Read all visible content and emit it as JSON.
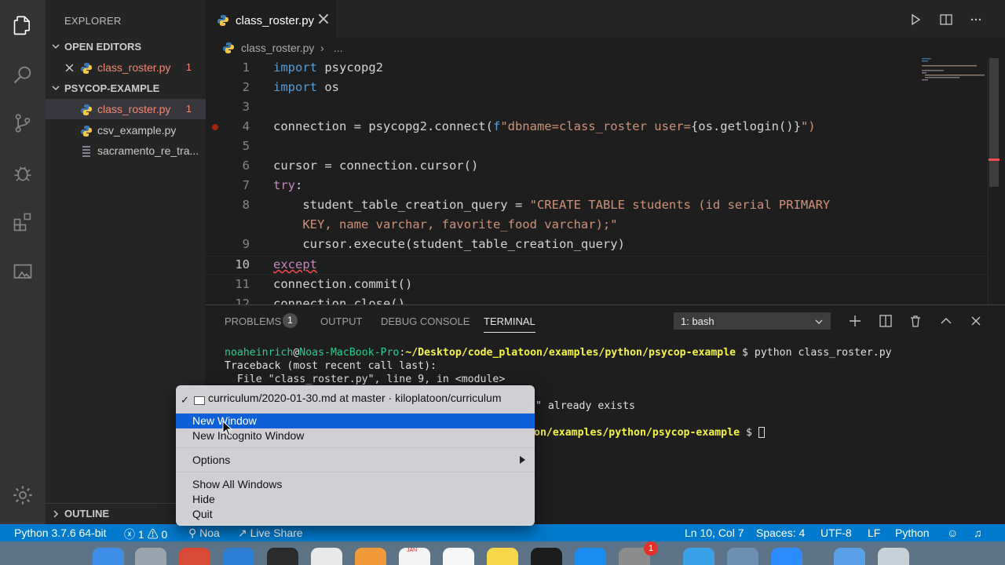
{
  "activity_bar": {
    "icons": [
      "files-icon",
      "search-icon",
      "source-control-icon",
      "debug-icon",
      "extensions-icon",
      "remote-explorer-icon",
      "settings-gear-icon"
    ]
  },
  "sidebar": {
    "title": "EXPLORER",
    "open_editors": {
      "label": "OPEN EDITORS",
      "items": [
        {
          "name": "class_roster.py",
          "problems": "1"
        }
      ]
    },
    "project": {
      "label": "PSYCOP-EXAMPLE",
      "files": [
        {
          "name": "class_roster.py",
          "problems": "1"
        },
        {
          "name": "csv_example.py"
        },
        {
          "name": "sacramento_re_tra..."
        }
      ]
    },
    "outline_label": "OUTLINE"
  },
  "editor": {
    "tab_label": "class_roster.py",
    "breadcrumb_file": "class_roster.py",
    "breadcrumb_rest": "...",
    "line_numbers": [
      "1",
      "2",
      "3",
      "4",
      "5",
      "6",
      "7",
      "8",
      "",
      "9",
      "10",
      "11",
      "12"
    ],
    "active_line": "10",
    "code": [
      {
        "kw": "import",
        "rest": " psycopg2"
      },
      {
        "kw": "import",
        "rest": " os"
      },
      {
        "text": ""
      },
      {
        "pre": "connection = psycopg2.connect(",
        "fpre": "f",
        "str": "\"dbname=class_roster user=",
        "mid": "{os.getlogin()}",
        "post": "\")"
      },
      {
        "text": ""
      },
      {
        "text": "cursor = connection.cursor()"
      },
      {
        "kw2": "try",
        "rest": ":"
      },
      {
        "indent": "    ",
        "pre": "student_table_creation_query = ",
        "str": "\"CREATE TABLE students (id serial PRIMARY"
      },
      {
        "indent": "    ",
        "str": "KEY, name varchar, favorite_food varchar);\""
      },
      {
        "text": "    cursor.execute(student_table_creation_query)"
      },
      {
        "err": "except"
      },
      {
        "text": "connection.commit()"
      },
      {
        "text": "connection.close()"
      }
    ]
  },
  "panel": {
    "tabs": [
      "PROBLEMS",
      "OUTPUT",
      "DEBUG CONSOLE",
      "TERMINAL"
    ],
    "problems_count": "1",
    "active_tab": "TERMINAL",
    "terminal_selector": "1: bash",
    "terminal_lines": [
      {
        "user": "noaheinrich",
        "at": "@",
        "host": "Noas-MacBook-Pro",
        "colon": ":",
        "path": "~/Desktop/code_platoon/examples/python/psycop-example",
        "cmd": " $ python class_roster.py"
      },
      {
        "text": "Traceback (most recent call last):"
      },
      {
        "text": "  File \"class_roster.py\", line 9, in <module>"
      },
      {
        "text": ""
      },
      {
        "partial": "s\" already exists"
      },
      {
        "text": ""
      },
      {
        "partial_path": "on/examples/python/psycop-example",
        "tail": " $ "
      }
    ]
  },
  "status_bar": {
    "python": "Python 3.7.6 64-bit",
    "errors": "1",
    "warnings": "0",
    "user": "Noa",
    "live_share": "Live Share",
    "position": "Ln 10, Col 7",
    "spaces": "Spaces: 4",
    "encoding": "UTF-8",
    "eol": "LF",
    "language": "Python"
  },
  "context_menu": {
    "window_item": "curriculum/2020-01-30.md at master · kiloplatoon/curriculum",
    "items": [
      "New Window",
      "New Incognito Window",
      "Options",
      "Show All Windows",
      "Hide",
      "Quit"
    ],
    "highlighted": "New Window"
  },
  "dock": {
    "calendar_month": "JAN",
    "badges": [
      "1"
    ]
  },
  "colors": {
    "accent": "#007acc",
    "menu_highlight": "#0f5fd8",
    "error": "#f48771"
  }
}
